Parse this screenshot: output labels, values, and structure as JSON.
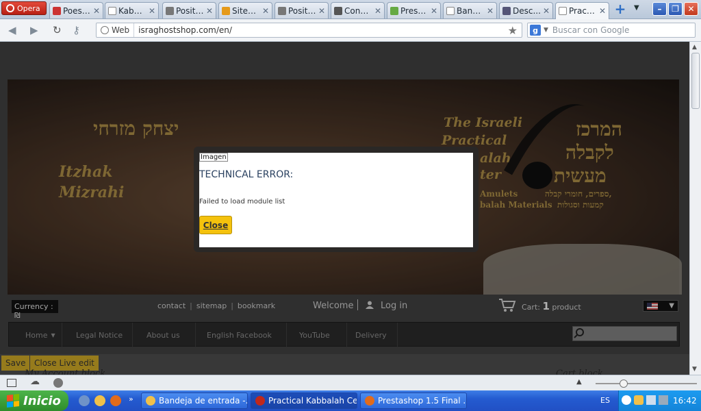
{
  "browser": {
    "opera_label": "Opera",
    "tabs": [
      {
        "label": "Poesí...",
        "fav": "#c33"
      },
      {
        "label": "Kabal...",
        "fav": "#9aa"
      },
      {
        "label": "Positi...",
        "fav": "#777"
      },
      {
        "label": "SiteG...",
        "fav": "#e69a1a"
      },
      {
        "label": "Positi...",
        "fav": "#777"
      },
      {
        "label": "Cons...",
        "fav": "#555"
      },
      {
        "label": "Prest...",
        "fav": "#6a4"
      },
      {
        "label": "Band...",
        "fav": "#9aa"
      },
      {
        "label": "Desc...",
        "fav": "#557"
      },
      {
        "label": "Practi...",
        "fav": "#9aa"
      }
    ],
    "web_label": "Web",
    "url": "israghostshop.com/en/",
    "search_placeholder": "Buscar con Google"
  },
  "shop": {
    "banner": {
      "name_he": "יצחק מזרחי",
      "name_en": "Itzhak Mizrahi",
      "center_en_1": "The Israeli",
      "center_en_2": "Practical",
      "center_en_3": "alah",
      "center_en_4": "ter",
      "center_he_1": "המרכז",
      "center_he_2": "לקבלה",
      "center_he_3": "מעשית",
      "amulets": "Amulets",
      "materials": "balah Materials",
      "he_sub_1": "ספרים, חומרי קבלה,",
      "he_sub_2": "קמעות וסגולות"
    },
    "currency": "Currency : ₪",
    "links": [
      "contact",
      "sitemap",
      "bookmark"
    ],
    "welcome": "Welcome",
    "login": "Log in",
    "cart_prefix": "Cart:",
    "cart_count": "1",
    "cart_suffix": "product",
    "menu": [
      "Home",
      "Legal Notice",
      "About us",
      "English Facebook",
      "YouTube",
      "Delivery"
    ],
    "edit_buttons": [
      "Save",
      "Close Live edit"
    ],
    "blocks": [
      "My Account block",
      "",
      "Cart block"
    ]
  },
  "modal": {
    "image_alt": "Imagen",
    "title": "TECHNICAL ERROR:",
    "message": "Failed to load module list",
    "close_label": "Close"
  },
  "taskbar": {
    "start_label": "Inicio",
    "tasks": [
      {
        "label": "Bandeja de entrada -...",
        "icon": "#f0c04a"
      },
      {
        "label": "Practical Kabbalah Ce...",
        "icon": "#c0281b"
      },
      {
        "label": "Prestashop 1.5 Final ...",
        "icon": "#e26b1b"
      }
    ],
    "language": "ES",
    "clock": "16:42"
  }
}
